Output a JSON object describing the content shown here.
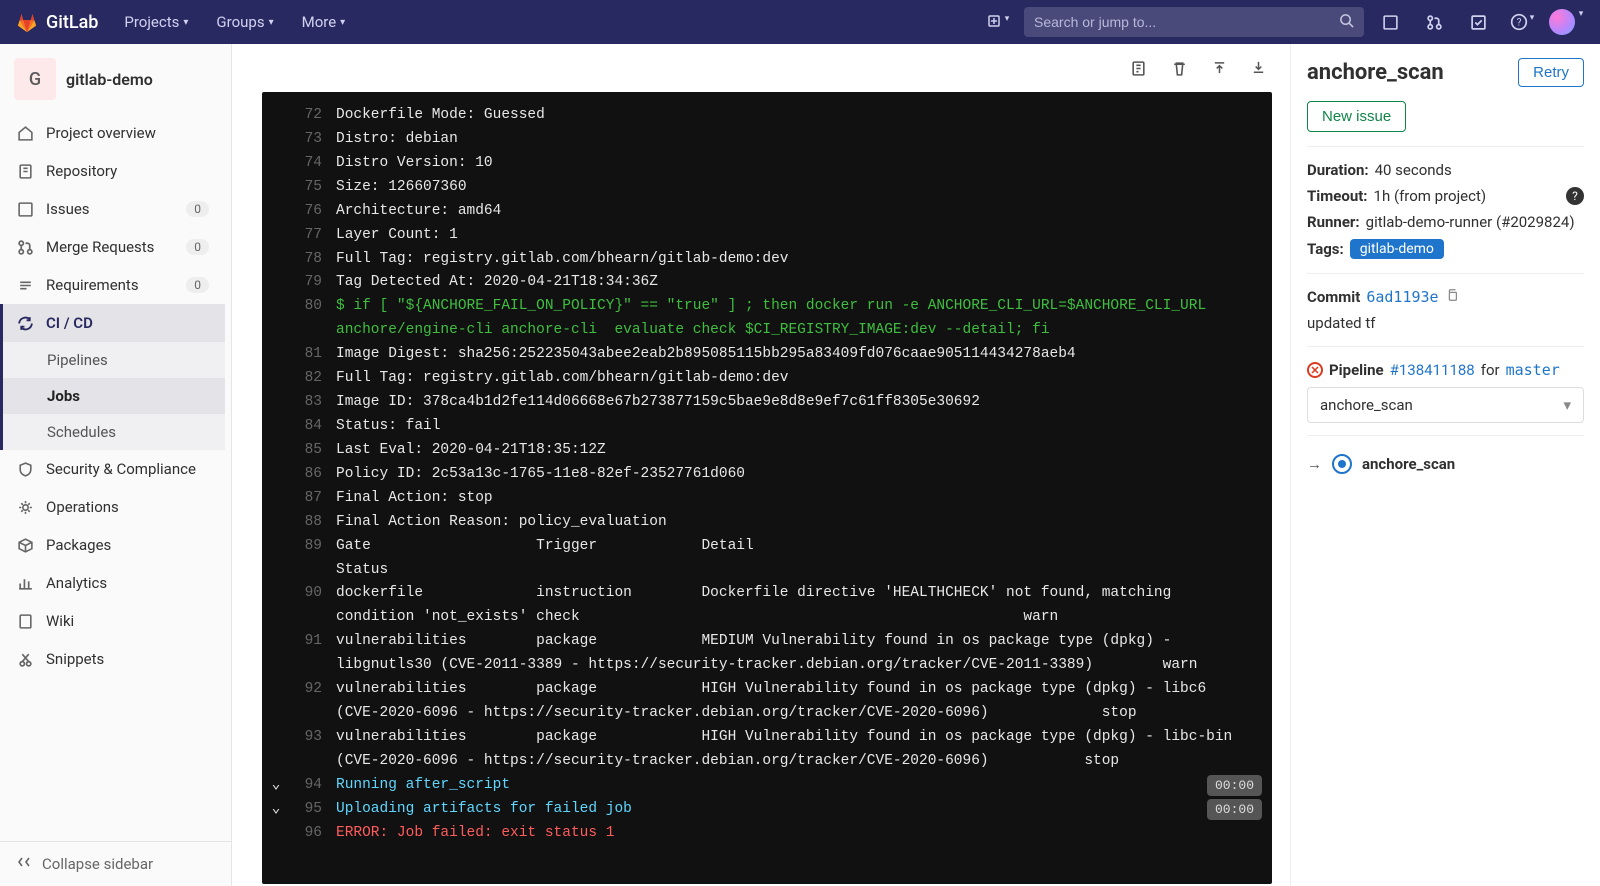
{
  "navbar": {
    "brand": "GitLab",
    "items": [
      "Projects",
      "Groups",
      "More"
    ],
    "search_placeholder": "Search or jump to..."
  },
  "sidebar": {
    "project_initial": "G",
    "project_name": "gitlab-demo",
    "items": [
      {
        "icon": "home",
        "label": "Project overview"
      },
      {
        "icon": "repo",
        "label": "Repository"
      },
      {
        "icon": "issues",
        "label": "Issues",
        "badge": "0"
      },
      {
        "icon": "merge",
        "label": "Merge Requests",
        "badge": "0"
      },
      {
        "icon": "req",
        "label": "Requirements",
        "badge": "0"
      },
      {
        "icon": "cicd",
        "label": "CI / CD",
        "active": true,
        "sub": [
          {
            "label": "Pipelines"
          },
          {
            "label": "Jobs",
            "active": true
          },
          {
            "label": "Schedules"
          }
        ]
      },
      {
        "icon": "shield",
        "label": "Security & Compliance"
      },
      {
        "icon": "ops",
        "label": "Operations"
      },
      {
        "icon": "package",
        "label": "Packages"
      },
      {
        "icon": "analytics",
        "label": "Analytics"
      },
      {
        "icon": "wiki",
        "label": "Wiki"
      },
      {
        "icon": "snippets",
        "label": "Snippets"
      }
    ],
    "collapse_label": "Collapse sidebar"
  },
  "log": {
    "lines": [
      {
        "n": 72,
        "t": "Dockerfile Mode: Guessed"
      },
      {
        "n": 73,
        "t": "Distro: debian"
      },
      {
        "n": 74,
        "t": "Distro Version: 10"
      },
      {
        "n": 75,
        "t": "Size: 126607360"
      },
      {
        "n": 76,
        "t": "Architecture: amd64"
      },
      {
        "n": 77,
        "t": "Layer Count: 1"
      },
      {
        "n": 78,
        "t": "Full Tag: registry.gitlab.com/bhearn/gitlab-demo:dev"
      },
      {
        "n": 79,
        "t": "Tag Detected At: 2020-04-21T18:34:36Z"
      },
      {
        "n": 80,
        "t": "$ if [ \"${ANCHORE_FAIL_ON_POLICY}\" == \"true\" ] ; then docker run -e ANCHORE_CLI_URL=$ANCHORE_CLI_URL anchore/engine-cli anchore-cli  evaluate check $CI_REGISTRY_IMAGE:dev --detail; fi",
        "cls": "green"
      },
      {
        "n": 81,
        "t": "Image Digest: sha256:252235043abee2eab2b895085115bb295a83409fd076caae905114434278aeb4"
      },
      {
        "n": 82,
        "t": "Full Tag: registry.gitlab.com/bhearn/gitlab-demo:dev"
      },
      {
        "n": 83,
        "t": "Image ID: 378ca4b1d2fe114d06668e67b273877159c5bae9e8d8e9ef7c61ff8305e30692"
      },
      {
        "n": 84,
        "t": "Status: fail"
      },
      {
        "n": 85,
        "t": "Last Eval: 2020-04-21T18:35:12Z"
      },
      {
        "n": 86,
        "t": "Policy ID: 2c53a13c-1765-11e8-82ef-23527761d060"
      },
      {
        "n": 87,
        "t": "Final Action: stop"
      },
      {
        "n": 88,
        "t": "Final Action Reason: policy_evaluation"
      },
      {
        "n": 89,
        "t": "Gate                   Trigger            Detail                                                               Status"
      },
      {
        "n": 90,
        "t": "dockerfile             instruction        Dockerfile directive 'HEALTHCHECK' not found, matching condition 'not_exists' check                                                   warn"
      },
      {
        "n": 91,
        "t": "vulnerabilities        package            MEDIUM Vulnerability found in os package type (dpkg) - libgnutls30 (CVE-2011-3389 - https://security-tracker.debian.org/tracker/CVE-2011-3389)        warn"
      },
      {
        "n": 92,
        "t": "vulnerabilities        package            HIGH Vulnerability found in os package type (dpkg) - libc6 (CVE-2020-6096 - https://security-tracker.debian.org/tracker/CVE-2020-6096)             stop"
      },
      {
        "n": 93,
        "t": "vulnerabilities        package            HIGH Vulnerability found in os package type (dpkg) - libc-bin (CVE-2020-6096 - https://security-tracker.debian.org/tracker/CVE-2020-6096)           stop"
      },
      {
        "n": 94,
        "t": "Running after_script",
        "cls": "cyan",
        "chev": true,
        "time": "00:00"
      },
      {
        "n": 95,
        "t": "Uploading artifacts for failed job",
        "cls": "cyan",
        "chev": true,
        "time": "00:00"
      },
      {
        "n": 96,
        "t": "ERROR: Job failed: exit status 1",
        "cls": "red"
      }
    ]
  },
  "details": {
    "title": "anchore_scan",
    "retry_label": "Retry",
    "new_issue_label": "New issue",
    "duration_label": "Duration:",
    "duration_value": "40 seconds",
    "timeout_label": "Timeout:",
    "timeout_value": "1h (from project)",
    "runner_label": "Runner:",
    "runner_value": "gitlab-demo-runner (#2029824)",
    "tags_label": "Tags:",
    "tag_value": "gitlab-demo",
    "commit_label": "Commit",
    "commit_sha": "6ad1193e",
    "commit_msg": "updated tf",
    "pipeline_label": "Pipeline",
    "pipeline_id": "#138411188",
    "pipeline_for": "for",
    "pipeline_branch": "master",
    "dropdown_value": "anchore_scan",
    "stage_job": "anchore_scan"
  }
}
